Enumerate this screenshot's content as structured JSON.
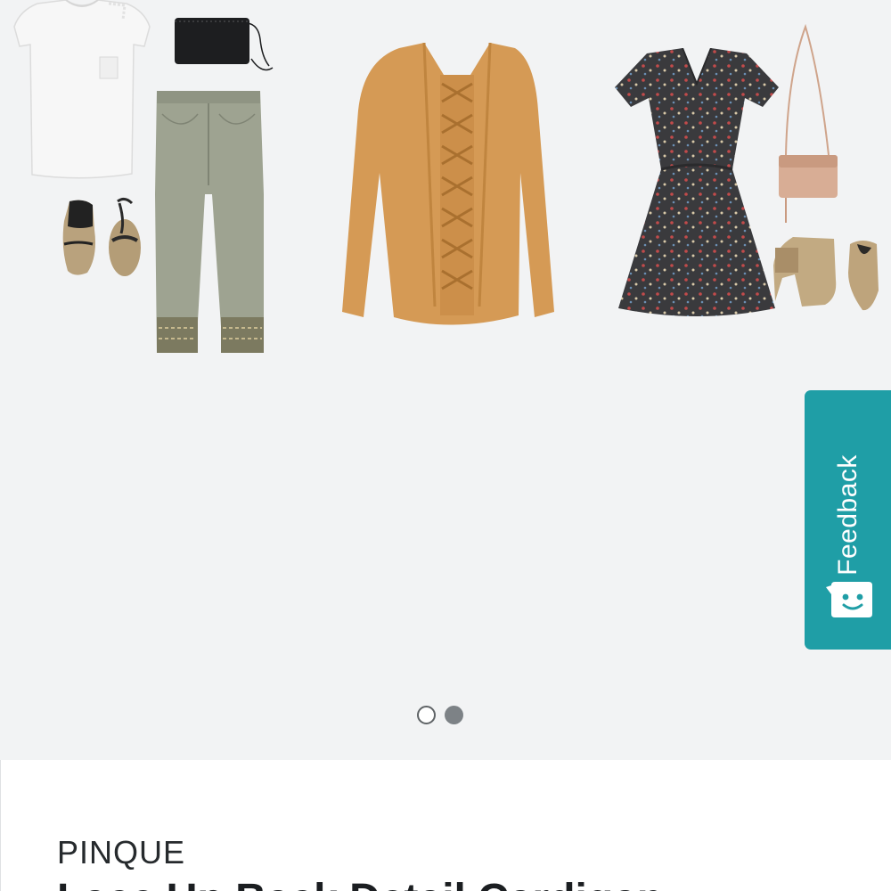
{
  "feedback": {
    "label": "Feedback",
    "icon": "chat-smiley-icon",
    "color": "#1f9ea6"
  },
  "carousel": {
    "background": "#f2f3f4",
    "slides_total": 2,
    "active_slide": 2,
    "items": [
      {
        "name": "white-tee",
        "icon": "tshirt-icon"
      },
      {
        "name": "black-crossbody",
        "icon": "handbag-icon"
      },
      {
        "name": "espadrille-sandals",
        "icon": "sandal-icon"
      },
      {
        "name": "olive-embroidered-jeans",
        "icon": "pants-icon"
      },
      {
        "name": "camel-cardigan",
        "icon": "cardigan-icon"
      },
      {
        "name": "floral-wrap-dress",
        "icon": "dress-icon"
      },
      {
        "name": "blush-crossbody",
        "icon": "handbag-icon"
      },
      {
        "name": "tan-booties",
        "icon": "boot-icon"
      }
    ]
  },
  "product": {
    "brand": "PINQUE",
    "title": "Lace Up Back Detail Cardigan"
  }
}
